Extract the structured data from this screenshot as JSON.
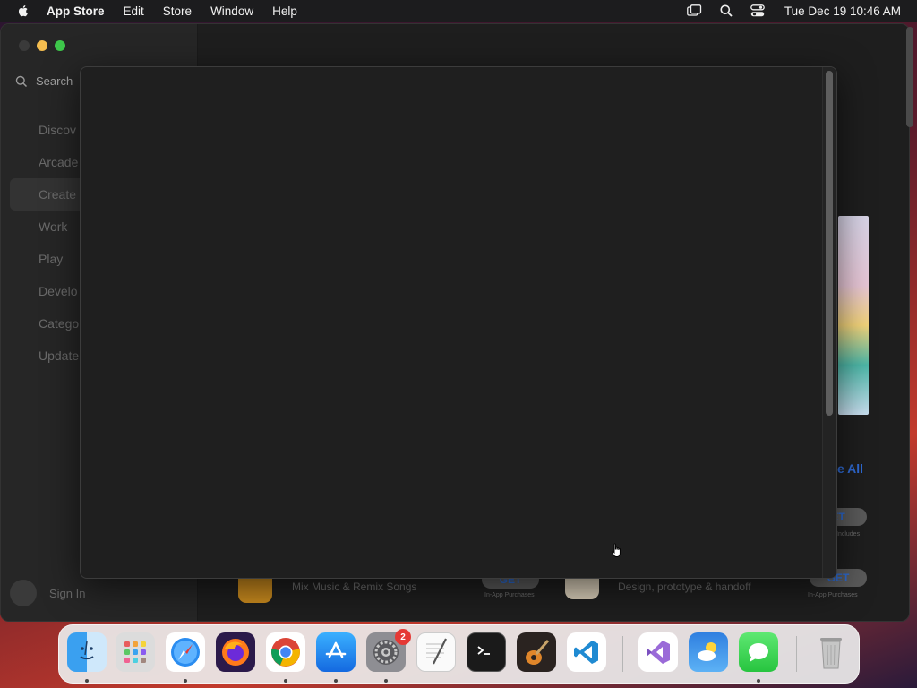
{
  "menubar": {
    "app_name": "App Store",
    "menus": [
      "Edit",
      "Store",
      "Window",
      "Help"
    ],
    "clock": "Tue Dec 19  10:46 AM",
    "status_icons": [
      "screen-mirroring-icon",
      "spotlight-search-icon",
      "control-center-icon"
    ]
  },
  "sidebar": {
    "search_placeholder": "Search",
    "items": [
      {
        "label": "Discov",
        "icon": "star-icon"
      },
      {
        "label": "Arcade",
        "icon": "joystick-icon"
      },
      {
        "label": "Create",
        "icon": "brush-icon",
        "active": true
      },
      {
        "label": "Work",
        "icon": "paperplane-icon"
      },
      {
        "label": "Play",
        "icon": "rocket-icon"
      },
      {
        "label": "Develo",
        "icon": "hammer-icon"
      },
      {
        "label": "Catego",
        "icon": "grid-icon"
      },
      {
        "label": "Update",
        "icon": "download-icon"
      }
    ],
    "sign_in": "Sign In"
  },
  "main": {
    "see_all": "e All",
    "rows": [
      {
        "subtitle": "Mix Music & Remix Songs",
        "button": "GET",
        "note": "In-App Purchases"
      },
      {
        "subtitle": "Design, prototype & handoff",
        "button": "GET",
        "note": "In-App Purchases"
      }
    ],
    "top_button": "ET",
    "top_note": "Includes"
  },
  "dock": {
    "apps": [
      {
        "name": "finder",
        "running": true
      },
      {
        "name": "launchpad",
        "running": false
      },
      {
        "name": "safari",
        "running": true
      },
      {
        "name": "firefox",
        "running": false
      },
      {
        "name": "chrome",
        "running": true
      },
      {
        "name": "app-store",
        "running": true
      },
      {
        "name": "system-settings",
        "running": true,
        "badge": "2"
      },
      {
        "name": "textedit",
        "running": false
      },
      {
        "name": "terminal",
        "running": false
      },
      {
        "name": "garageband",
        "running": false
      },
      {
        "name": "vscode",
        "running": false
      },
      {
        "name": "visual-studio",
        "running": false
      },
      {
        "name": "weather",
        "running": false
      },
      {
        "name": "messages",
        "running": true
      },
      {
        "name": "trash",
        "running": false
      }
    ]
  },
  "colors": {
    "accent": "#2f6bd6",
    "menubar_bg": "#1c1c1e",
    "panel_bg": "#1f1f1f",
    "badge": "#e53935"
  }
}
